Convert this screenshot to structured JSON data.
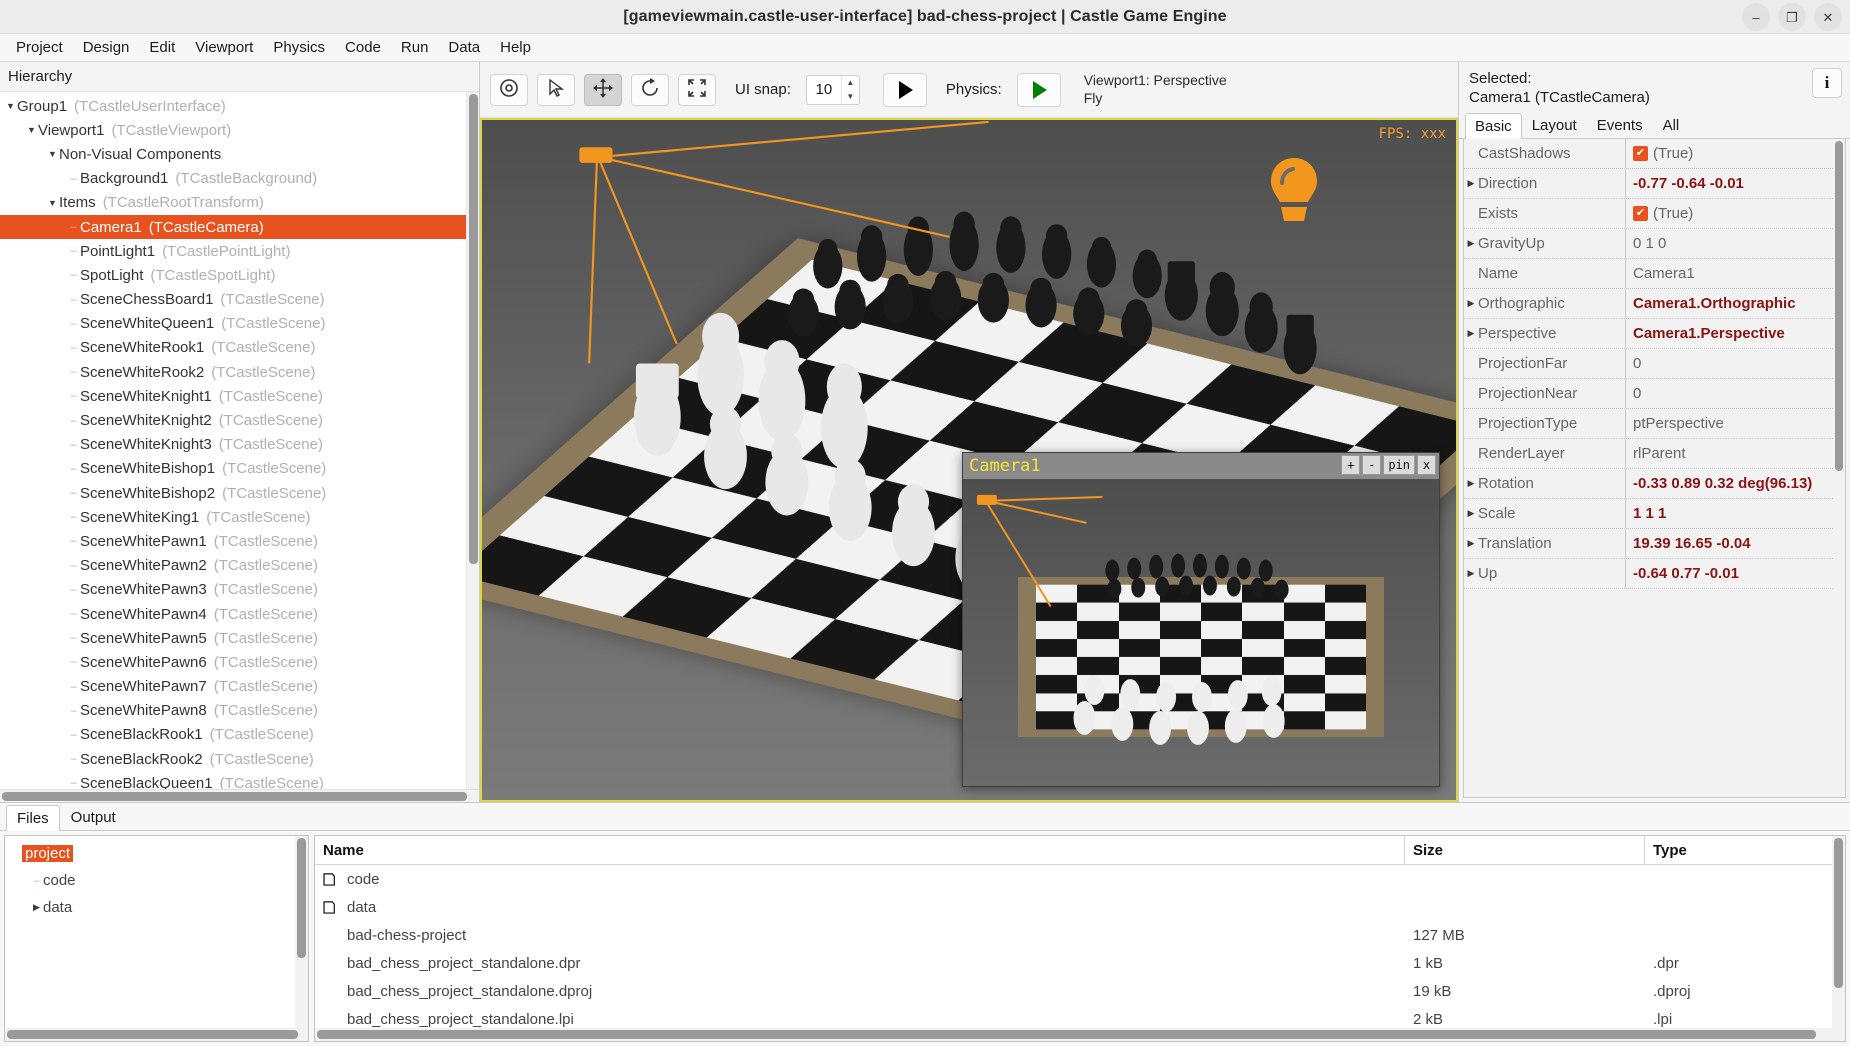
{
  "window": {
    "title": "[gameviewmain.castle-user-interface] bad-chess-project | Castle Game Engine",
    "minimize_label": "–",
    "maximize_label": "❐",
    "close_label": "✕"
  },
  "menubar": {
    "items": [
      "Project",
      "Design",
      "Edit",
      "Viewport",
      "Physics",
      "Code",
      "Run",
      "Data",
      "Help"
    ]
  },
  "hierarchy": {
    "header": "Hierarchy",
    "nodes": [
      {
        "name": "Group1",
        "class": "(TCastleUserInterface)",
        "depth": 0,
        "marker": "arrow",
        "selected": false
      },
      {
        "name": "Viewport1",
        "class": "(TCastleViewport)",
        "depth": 1,
        "marker": "arrow",
        "selected": false
      },
      {
        "name": "Non-Visual Components",
        "class": "",
        "depth": 2,
        "marker": "arrow",
        "selected": false
      },
      {
        "name": "Background1",
        "class": "(TCastleBackground)",
        "depth": 3,
        "marker": "dash",
        "selected": false
      },
      {
        "name": "Items",
        "class": "(TCastleRootTransform)",
        "depth": 2,
        "marker": "arrow",
        "selected": false
      },
      {
        "name": "Camera1",
        "class": "(TCastleCamera)",
        "depth": 3,
        "marker": "dash",
        "selected": true
      },
      {
        "name": "PointLight1",
        "class": "(TCastlePointLight)",
        "depth": 3,
        "marker": "dash",
        "selected": false
      },
      {
        "name": "SpotLight",
        "class": "(TCastleSpotLight)",
        "depth": 3,
        "marker": "dash",
        "selected": false
      },
      {
        "name": "SceneChessBoard1",
        "class": "(TCastleScene)",
        "depth": 3,
        "marker": "dash",
        "selected": false
      },
      {
        "name": "SceneWhiteQueen1",
        "class": "(TCastleScene)",
        "depth": 3,
        "marker": "dash",
        "selected": false
      },
      {
        "name": "SceneWhiteRook1",
        "class": "(TCastleScene)",
        "depth": 3,
        "marker": "dash",
        "selected": false
      },
      {
        "name": "SceneWhiteRook2",
        "class": "(TCastleScene)",
        "depth": 3,
        "marker": "dash",
        "selected": false
      },
      {
        "name": "SceneWhiteKnight1",
        "class": "(TCastleScene)",
        "depth": 3,
        "marker": "dash",
        "selected": false
      },
      {
        "name": "SceneWhiteKnight2",
        "class": "(TCastleScene)",
        "depth": 3,
        "marker": "dash",
        "selected": false
      },
      {
        "name": "SceneWhiteKnight3",
        "class": "(TCastleScene)",
        "depth": 3,
        "marker": "dash",
        "selected": false
      },
      {
        "name": "SceneWhiteBishop1",
        "class": "(TCastleScene)",
        "depth": 3,
        "marker": "dash",
        "selected": false
      },
      {
        "name": "SceneWhiteBishop2",
        "class": "(TCastleScene)",
        "depth": 3,
        "marker": "dash",
        "selected": false
      },
      {
        "name": "SceneWhiteKing1",
        "class": "(TCastleScene)",
        "depth": 3,
        "marker": "dash",
        "selected": false
      },
      {
        "name": "SceneWhitePawn1",
        "class": "(TCastleScene)",
        "depth": 3,
        "marker": "dash",
        "selected": false
      },
      {
        "name": "SceneWhitePawn2",
        "class": "(TCastleScene)",
        "depth": 3,
        "marker": "dash",
        "selected": false
      },
      {
        "name": "SceneWhitePawn3",
        "class": "(TCastleScene)",
        "depth": 3,
        "marker": "dash",
        "selected": false
      },
      {
        "name": "SceneWhitePawn4",
        "class": "(TCastleScene)",
        "depth": 3,
        "marker": "dash",
        "selected": false
      },
      {
        "name": "SceneWhitePawn5",
        "class": "(TCastleScene)",
        "depth": 3,
        "marker": "dash",
        "selected": false
      },
      {
        "name": "SceneWhitePawn6",
        "class": "(TCastleScene)",
        "depth": 3,
        "marker": "dash",
        "selected": false
      },
      {
        "name": "SceneWhitePawn7",
        "class": "(TCastleScene)",
        "depth": 3,
        "marker": "dash",
        "selected": false
      },
      {
        "name": "SceneWhitePawn8",
        "class": "(TCastleScene)",
        "depth": 3,
        "marker": "dash",
        "selected": false
      },
      {
        "name": "SceneBlackRook1",
        "class": "(TCastleScene)",
        "depth": 3,
        "marker": "dash",
        "selected": false
      },
      {
        "name": "SceneBlackRook2",
        "class": "(TCastleScene)",
        "depth": 3,
        "marker": "dash",
        "selected": false
      },
      {
        "name": "SceneBlackQueen1",
        "class": "(TCastleScene)",
        "depth": 3,
        "marker": "dash",
        "selected": false
      }
    ]
  },
  "toolbar": {
    "buttons": [
      {
        "icon": "eye-icon",
        "name": "toggle-visibility-button",
        "active": false
      },
      {
        "icon": "cursor-arrow-icon",
        "name": "select-tool-button",
        "active": false
      },
      {
        "icon": "move-arrows-icon",
        "name": "translate-tool-button",
        "active": true
      },
      {
        "icon": "rotate-icon",
        "name": "rotate-tool-button",
        "active": false
      },
      {
        "icon": "scale-icon",
        "name": "scale-tool-button",
        "active": false
      }
    ],
    "ui_snap_label": "UI snap:",
    "ui_snap_value": "10",
    "run_label": "▶",
    "physics_label": "Physics:",
    "physics_play_color": "#008000"
  },
  "viewport": {
    "status_line1": "Viewport1: Perspective",
    "status_line2": "Fly",
    "fps": "FPS: xxx",
    "border_color": "#d8d846",
    "gizmo_color": "#f2961e"
  },
  "camera_window": {
    "title": "Camera1",
    "buttons": [
      "+",
      "-",
      "pin",
      "x"
    ]
  },
  "properties": {
    "selected_label": "Selected:",
    "selected_object": "Camera1 (TCastleCamera)",
    "info_icon": "i",
    "tabs": [
      {
        "label": "Basic",
        "selected": true
      },
      {
        "label": "Layout",
        "selected": false
      },
      {
        "label": "Events",
        "selected": false
      },
      {
        "label": "All",
        "selected": false
      }
    ],
    "rows": [
      {
        "name": "CastShadows",
        "value": "(True)",
        "expandable": false,
        "modified": false,
        "checkbox": true
      },
      {
        "name": "Direction",
        "value": "-0.77 -0.64 -0.01",
        "expandable": true,
        "modified": true,
        "checkbox": false
      },
      {
        "name": "Exists",
        "value": "(True)",
        "expandable": false,
        "modified": false,
        "checkbox": true
      },
      {
        "name": "GravityUp",
        "value": "0 1 0",
        "expandable": true,
        "modified": false,
        "checkbox": false
      },
      {
        "name": "Name",
        "value": "Camera1",
        "expandable": false,
        "modified": false,
        "checkbox": false
      },
      {
        "name": "Orthographic",
        "value": "Camera1.Orthographic",
        "expandable": true,
        "modified": true,
        "checkbox": false
      },
      {
        "name": "Perspective",
        "value": "Camera1.Perspective",
        "expandable": true,
        "modified": true,
        "checkbox": false
      },
      {
        "name": "ProjectionFar",
        "value": "0",
        "expandable": false,
        "modified": false,
        "checkbox": false
      },
      {
        "name": "ProjectionNear",
        "value": "0",
        "expandable": false,
        "modified": false,
        "checkbox": false
      },
      {
        "name": "ProjectionType",
        "value": "ptPerspective",
        "expandable": false,
        "modified": false,
        "checkbox": false
      },
      {
        "name": "RenderLayer",
        "value": "rlParent",
        "expandable": false,
        "modified": false,
        "checkbox": false
      },
      {
        "name": "Rotation",
        "value": "-0.33 0.89 0.32 deg(96.13)",
        "expandable": true,
        "modified": true,
        "checkbox": false
      },
      {
        "name": "Scale",
        "value": "1 1 1",
        "expandable": true,
        "modified": true,
        "checkbox": false
      },
      {
        "name": "Translation",
        "value": "19.39 16.65 -0.04",
        "expandable": true,
        "modified": true,
        "checkbox": false
      },
      {
        "name": "Up",
        "value": "-0.64 0.77 -0.01",
        "expandable": true,
        "modified": true,
        "checkbox": false
      }
    ]
  },
  "bottom_panel": {
    "tabs": [
      {
        "label": "Files",
        "selected": true
      },
      {
        "label": "Output",
        "selected": false
      }
    ],
    "folder_tree": [
      {
        "label": "project",
        "depth": 0,
        "marker": "none",
        "selected": true
      },
      {
        "label": "code",
        "depth": 1,
        "marker": "dash",
        "selected": false
      },
      {
        "label": "data",
        "depth": 1,
        "marker": "arrow",
        "selected": false
      }
    ],
    "columns": [
      "Name",
      "Size",
      "Type"
    ],
    "files": [
      {
        "name": "code",
        "size": "",
        "type": "",
        "is_folder": true
      },
      {
        "name": "data",
        "size": "",
        "type": "",
        "is_folder": true
      },
      {
        "name": "bad-chess-project",
        "size": "127 MB",
        "type": "",
        "is_folder": false
      },
      {
        "name": "bad_chess_project_standalone.dpr",
        "size": "1 kB",
        "type": ".dpr",
        "is_folder": false
      },
      {
        "name": "bad_chess_project_standalone.dproj",
        "size": "19 kB",
        "type": ".dproj",
        "is_folder": false
      },
      {
        "name": "bad_chess_project_standalone.lpi",
        "size": "2 kB",
        "type": ".lpi",
        "is_folder": false
      }
    ]
  }
}
